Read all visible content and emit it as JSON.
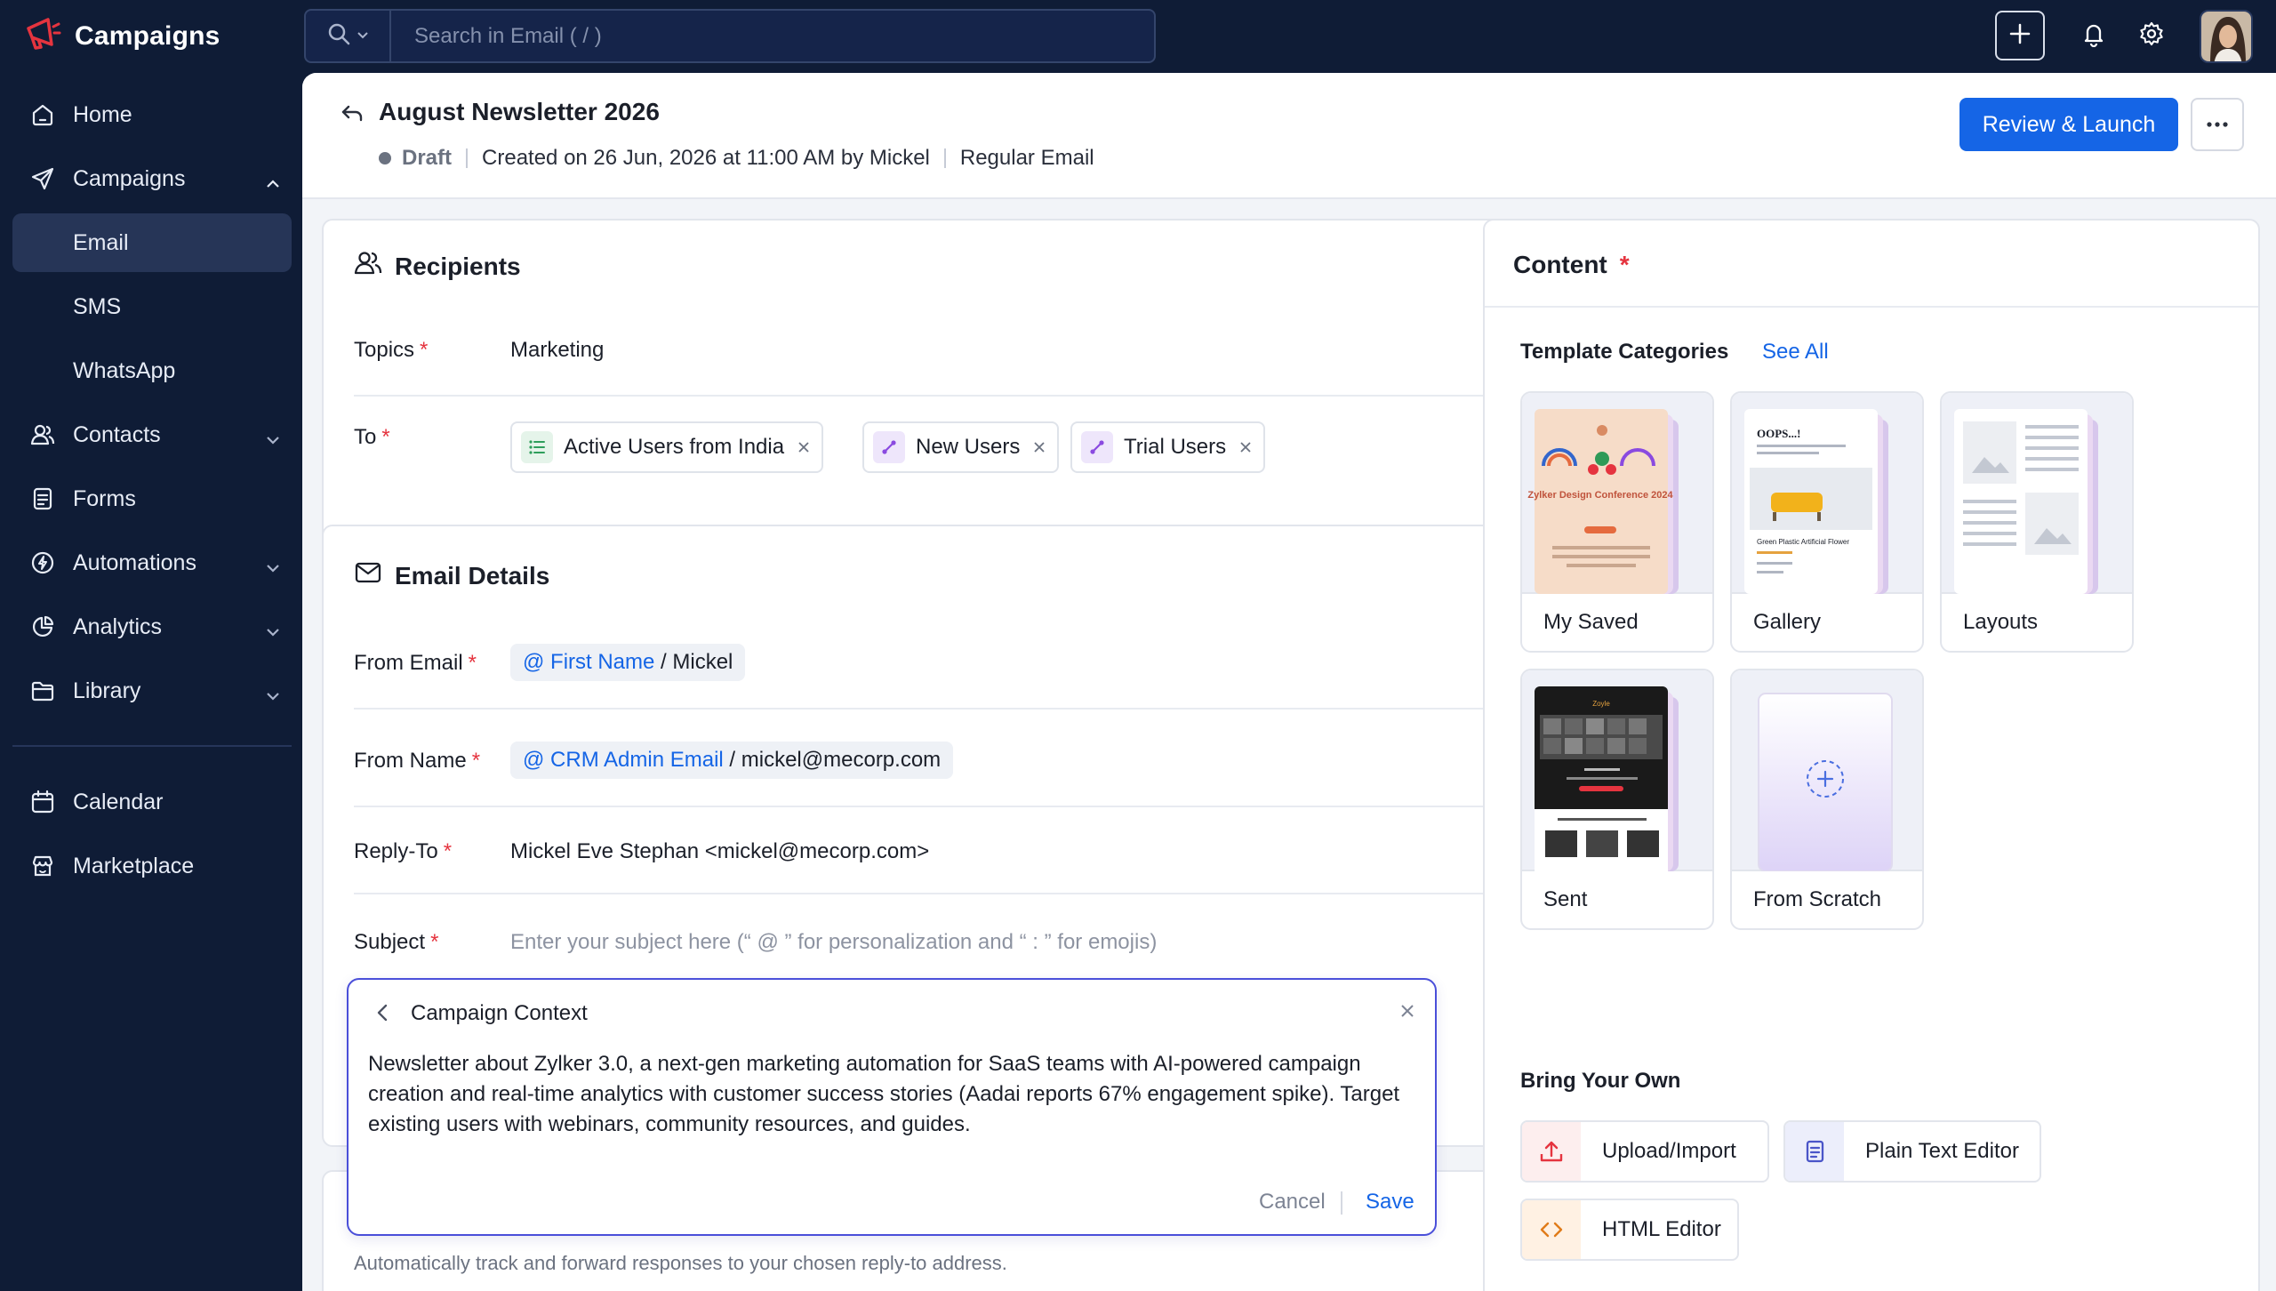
{
  "app": {
    "brand": "Campaigns",
    "search_placeholder": "Search in Email ( / )"
  },
  "sidebar": {
    "items": [
      {
        "label": "Home"
      },
      {
        "label": "Campaigns"
      },
      {
        "label": "Email"
      },
      {
        "label": "SMS"
      },
      {
        "label": "WhatsApp"
      },
      {
        "label": "Contacts"
      },
      {
        "label": "Forms"
      },
      {
        "label": "Automations"
      },
      {
        "label": "Analytics"
      },
      {
        "label": "Library"
      },
      {
        "label": "Calendar"
      },
      {
        "label": "Marketplace"
      }
    ]
  },
  "header": {
    "title": "August Newsletter 2026",
    "status": "Draft",
    "created": "Created on 26 Jun, 2026 at 11:00 AM by Mickel",
    "type": "Regular Email",
    "review_button": "Review & Launch"
  },
  "recipients": {
    "title": "Recipients",
    "topics_label": "Topics",
    "topics_value": "Marketing",
    "to_label": "To",
    "lists": [
      "Active Users from India",
      "New Users",
      "Trial Users"
    ]
  },
  "email_details": {
    "title": "Email Details",
    "from_email_label": "From Email",
    "from_email_tag": "@ First Name",
    "from_email_value": "/ Mickel",
    "from_name_label": "From Name",
    "from_name_tag": "@ CRM Admin Email",
    "from_name_value": "/ mickel@mecorp.com",
    "reply_to_label": "Reply-To",
    "reply_to_value": "Mickel Eve Stephan <mickel@mecorp.com>",
    "subject_label": "Subject",
    "subject_placeholder": "Enter your subject here (“ @ ” for personalization and  “ : ” for emojis)",
    "helper": "Automatically track and forward responses to your chosen reply-to address."
  },
  "campaign_context": {
    "title": "Campaign Context",
    "text": "Newsletter about Zylker 3.0, a next-gen marketing automation for SaaS teams with AI-powered campaign creation and real-time analytics with customer success stories (Aadai reports 67% engagement spike). Target existing users with webinars, community resources, and guides.",
    "cancel": "Cancel",
    "save": "Save"
  },
  "content": {
    "title": "Content",
    "template_categories": "Template Categories",
    "see_all": "See All",
    "templates": [
      "My Saved",
      "Gallery",
      "Layouts",
      "Sent",
      "From Scratch"
    ],
    "thumb_texts": {
      "conference": "Zylker Design Conference 2024",
      "oops": "OOPS...!",
      "plastic": "Green Plastic Artificial Flower",
      "sent_logo": "Zoyle"
    },
    "bring_your_own": "Bring Your Own",
    "byo": [
      "Upload/Import",
      "Plain Text Editor",
      "HTML Editor"
    ]
  },
  "colors": {
    "primary": "#1565e6",
    "sidebar_bg": "#0f1c36",
    "required": "#e5343f",
    "context_border": "#4a4fd9"
  }
}
